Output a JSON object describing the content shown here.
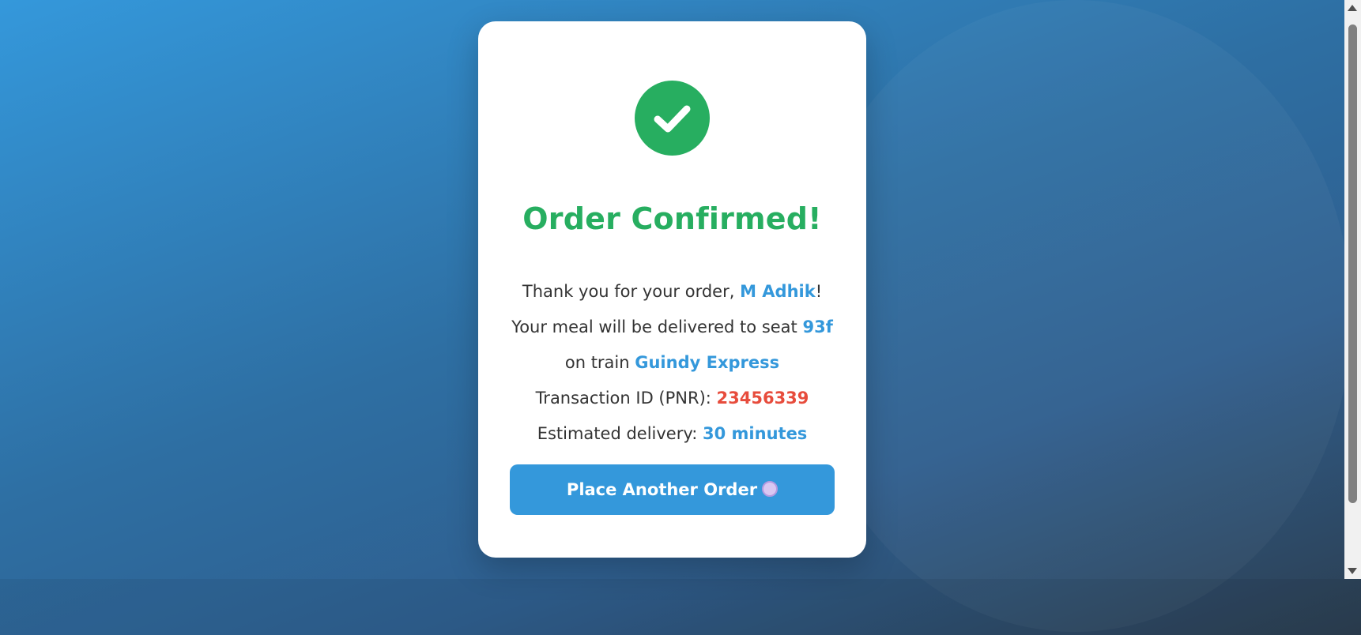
{
  "confirmation": {
    "title": "Order Confirmed!",
    "thank_you_prefix": "Thank you for your order, ",
    "customer_name": "M Adhik",
    "thank_you_suffix": "!",
    "seat_prefix": "Your meal will be delivered to seat ",
    "seat": "93f",
    "train_prefix": "on train ",
    "train_name": "Guindy Express",
    "pnr_prefix": "Transaction ID (PNR): ",
    "pnr": "23456339",
    "delivery_prefix": "Estimated delivery: ",
    "delivery_time": "30 minutes"
  },
  "actions": {
    "place_another_label": "Place Another Order"
  },
  "icons": {
    "status": "checkmark-icon",
    "button": "plate-icon"
  },
  "colors": {
    "success": "#27ae60",
    "accent": "#3498db",
    "pnr": "#e74c3c"
  }
}
